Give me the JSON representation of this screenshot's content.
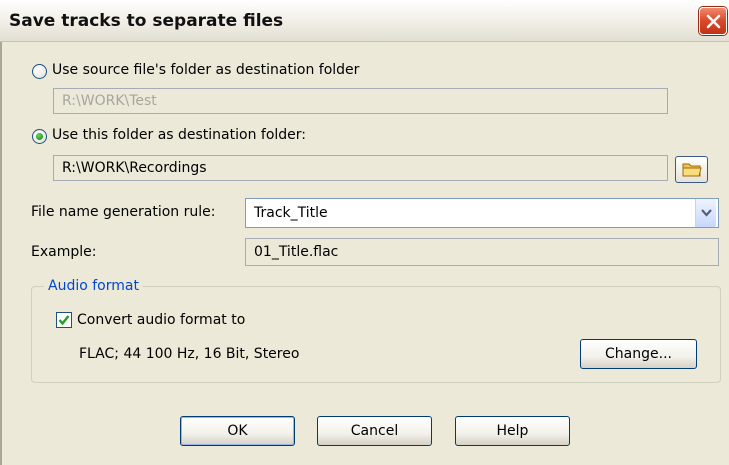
{
  "window": {
    "title": "Save tracks to separate files"
  },
  "destination": {
    "option_source_label": "Use source file's folder as destination folder",
    "source_folder_value": "R:\\WORK\\Test",
    "option_custom_label": "Use this folder as destination folder:",
    "custom_folder_value": "R:\\WORK\\Recordings",
    "selected_option": "custom"
  },
  "naming": {
    "rule_label": "File name generation rule:",
    "rule_value": "Track_Title",
    "example_label": "Example:",
    "example_value": "01_Title.flac"
  },
  "audio_format": {
    "group_title": "Audio format",
    "convert_label": "Convert audio format to",
    "convert_checked": true,
    "format_value": "FLAC; 44 100 Hz, 16 Bit, Stereo",
    "change_label": "Change..."
  },
  "buttons": {
    "ok": "OK",
    "cancel": "Cancel",
    "help": "Help"
  },
  "icons": {
    "close": "close-icon",
    "browse": "folder-icon",
    "dropdown": "chevron-down-icon",
    "check": "checkmark-icon"
  },
  "colors": {
    "dialog_bg": "#ece9d8",
    "group_title": "#0046d5",
    "close_button": "#d9492a",
    "radio_selected": "#21a121"
  }
}
